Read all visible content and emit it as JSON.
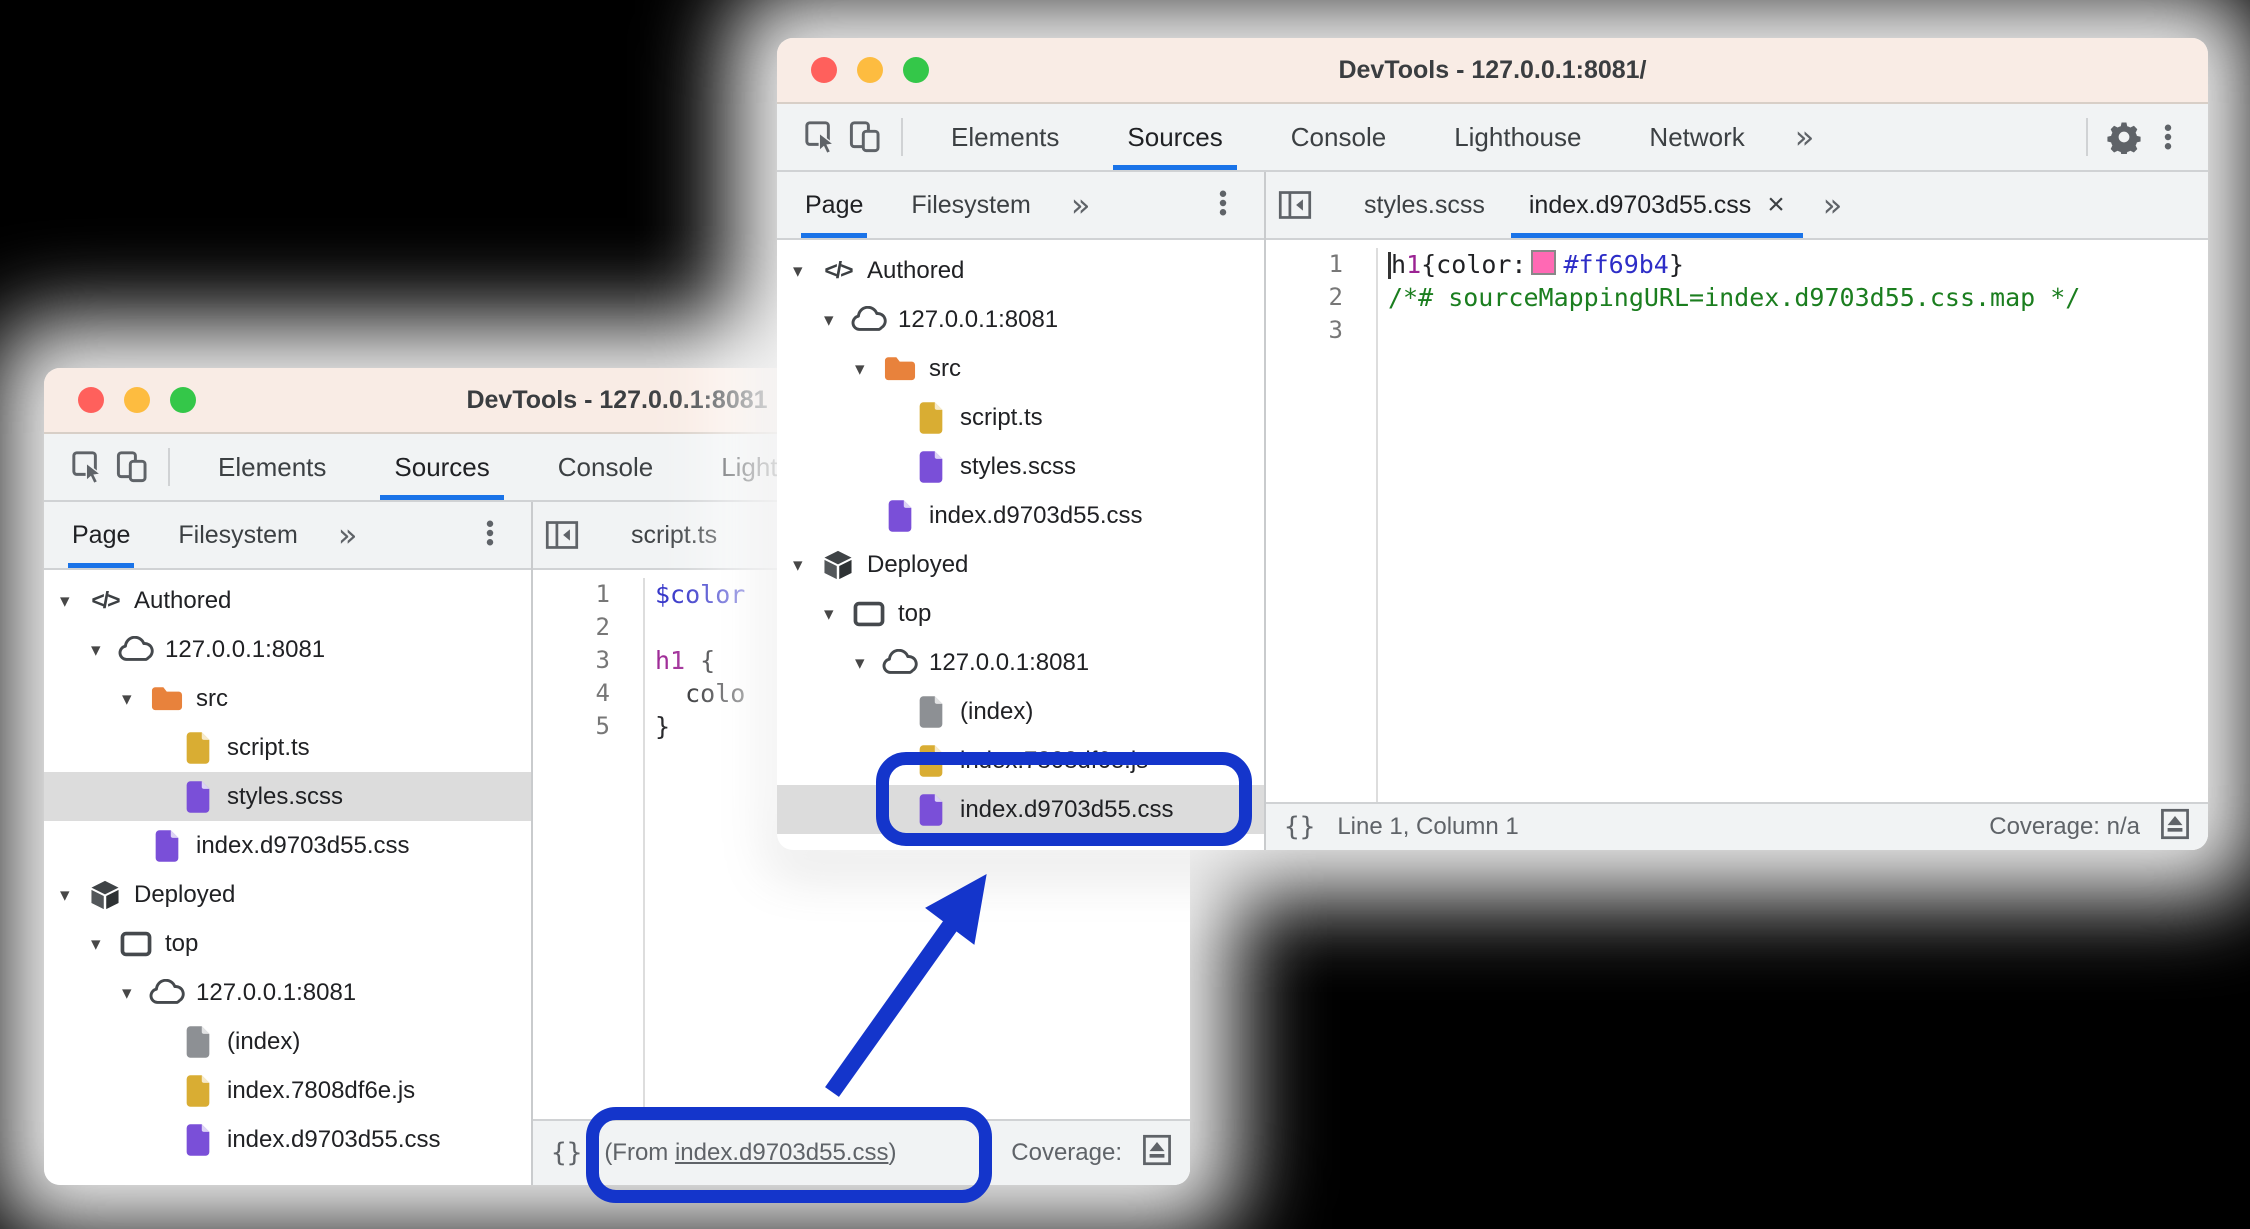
{
  "colors": {
    "accent": "#1a73e8",
    "annotation": "#1435cb",
    "swatch": "#ff69b4",
    "traffic_red": "#ff605c",
    "traffic_yellow": "#fdbc40",
    "traffic_green": "#34c749"
  },
  "token_colors": {
    "dark": "#202124",
    "purple": "#9b2393",
    "blue": "#2d2dc7",
    "green": "#1b7e1f"
  },
  "back_window": {
    "title": "DevTools - 127.0.0.1:8081",
    "more_symbol": "»",
    "toolbar_tabs": [
      {
        "label": "Elements"
      },
      {
        "label": "Sources",
        "active": true
      },
      {
        "label": "Console"
      },
      {
        "label": "Lighthouse"
      }
    ],
    "sidebar_tabs": [
      {
        "label": "Page",
        "active": true
      },
      {
        "label": "Filesystem"
      }
    ],
    "tree": [
      {
        "label": "Authored",
        "icon": "code",
        "depth": 0,
        "expanded": true
      },
      {
        "label": "127.0.0.1:8081",
        "icon": "cloud",
        "depth": 1,
        "expanded": true
      },
      {
        "label": "src",
        "icon": "folder",
        "depth": 2,
        "expanded": true
      },
      {
        "label": "script.ts",
        "icon": "file-yellow",
        "depth": 3
      },
      {
        "label": "styles.scss",
        "icon": "file-purple",
        "depth": 3,
        "selected": true
      },
      {
        "label": "index.d9703d55.css",
        "icon": "file-purple",
        "depth": 2
      },
      {
        "label": "Deployed",
        "icon": "cube",
        "depth": 0,
        "expanded": true
      },
      {
        "label": "top",
        "icon": "frame",
        "depth": 1,
        "expanded": true
      },
      {
        "label": "127.0.0.1:8081",
        "icon": "cloud",
        "depth": 2,
        "expanded": true
      },
      {
        "label": "(index)",
        "icon": "file-gray",
        "depth": 3
      },
      {
        "label": "index.7808df6e.js",
        "icon": "file-yellow",
        "depth": 3
      },
      {
        "label": "index.d9703d55.css",
        "icon": "file-purple",
        "depth": 3
      }
    ],
    "editor_tabs": [
      {
        "label": "script.ts"
      }
    ],
    "code": [
      {
        "num": "1",
        "tokens": [
          {
            "t": "$color",
            "c": "blue"
          }
        ]
      },
      {
        "num": "2",
        "tokens": []
      },
      {
        "num": "3",
        "tokens": [
          {
            "t": "h1",
            "c": "purple"
          },
          {
            "t": " {",
            "c": "dark"
          }
        ]
      },
      {
        "num": "4",
        "tokens": [
          {
            "t": "  colo",
            "c": "dark"
          }
        ]
      },
      {
        "num": "5",
        "tokens": [
          {
            "t": "}",
            "c": "dark"
          }
        ]
      }
    ],
    "statusbar": {
      "braces": "{}",
      "from_prefix": "(From ",
      "link": "index.d9703d55.css",
      "from_suffix": ")",
      "coverage": "Coverage:"
    }
  },
  "front_window": {
    "title": "DevTools - 127.0.0.1:8081/",
    "more_symbol": "»",
    "toolbar_more": true,
    "toolbar_controls": true,
    "editor_more": true,
    "toolbar_tabs": [
      {
        "label": "Elements"
      },
      {
        "label": "Sources",
        "active": true
      },
      {
        "label": "Console"
      },
      {
        "label": "Lighthouse"
      },
      {
        "label": "Network"
      }
    ],
    "sidebar_tabs": [
      {
        "label": "Page",
        "active": true
      },
      {
        "label": "Filesystem"
      }
    ],
    "tree": [
      {
        "label": "Authored",
        "icon": "code",
        "depth": 0,
        "expanded": true
      },
      {
        "label": "127.0.0.1:8081",
        "icon": "cloud",
        "depth": 1,
        "expanded": true
      },
      {
        "label": "src",
        "icon": "folder",
        "depth": 2,
        "expanded": true
      },
      {
        "label": "script.ts",
        "icon": "file-yellow",
        "depth": 3
      },
      {
        "label": "styles.scss",
        "icon": "file-purple",
        "depth": 3
      },
      {
        "label": "index.d9703d55.css",
        "icon": "file-purple",
        "depth": 2
      },
      {
        "label": "Deployed",
        "icon": "cube",
        "depth": 0,
        "expanded": true
      },
      {
        "label": "top",
        "icon": "frame",
        "depth": 1,
        "expanded": true
      },
      {
        "label": "127.0.0.1:8081",
        "icon": "cloud",
        "depth": 2,
        "expanded": true
      },
      {
        "label": "(index)",
        "icon": "file-gray",
        "depth": 3
      },
      {
        "label": "index.7808df6e.js",
        "icon": "file-yellow",
        "depth": 3
      },
      {
        "label": "index.d9703d55.css",
        "icon": "file-purple",
        "depth": 3,
        "selected": true
      }
    ],
    "editor_tabs": [
      {
        "label": "styles.scss"
      },
      {
        "label": "index.d9703d55.css",
        "active": true,
        "closable": true,
        "close_symbol": "×"
      }
    ],
    "code": [
      {
        "num": "1",
        "cursor": true,
        "tokens": [
          {
            "t": "h",
            "c": "dark"
          },
          {
            "t": "1",
            "c": "purple"
          },
          {
            "t": "{color:",
            "c": "dark"
          },
          {
            "swatch": true
          },
          {
            "t": "#ff69b4",
            "c": "blue"
          },
          {
            "t": "}",
            "c": "dark"
          }
        ]
      },
      {
        "num": "2",
        "tokens": [
          {
            "t": "/*# sourceMappingURL=index.d9703d55.css.map */",
            "c": "green"
          }
        ]
      },
      {
        "num": "3",
        "tokens": []
      }
    ],
    "statusbar": {
      "braces": "{}",
      "line_col": "Line 1, Column 1",
      "coverage": "Coverage: n/a"
    }
  }
}
